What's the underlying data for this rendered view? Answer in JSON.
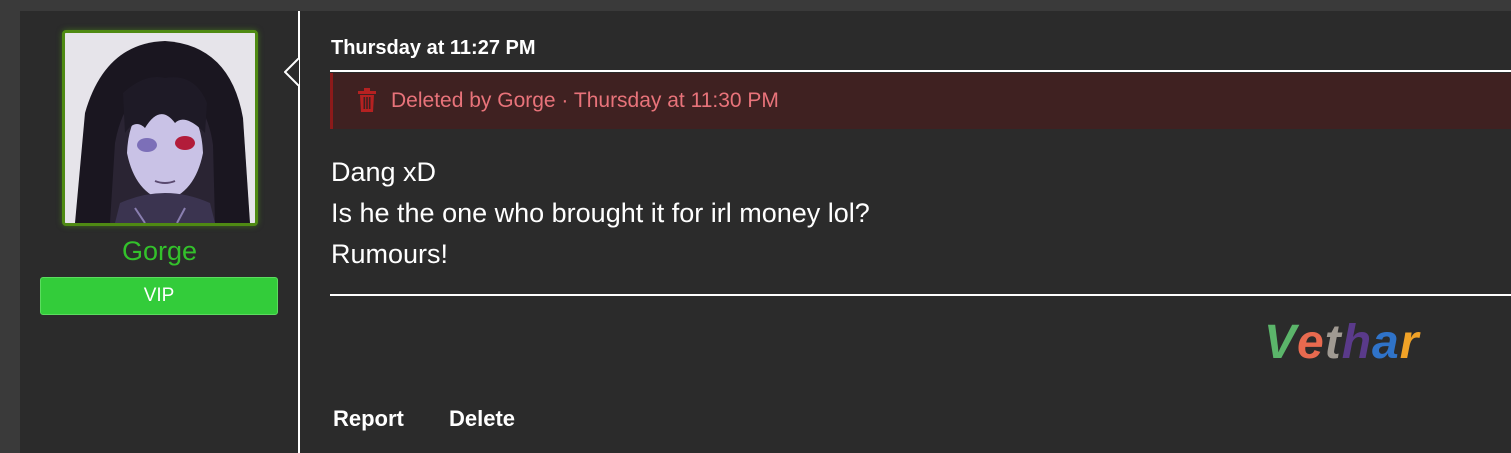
{
  "post": {
    "author": {
      "name": "Gorge",
      "badge": "VIP",
      "name_color": "#33c12b",
      "badge_color": "#33cc3a",
      "avatar_icon": "anime-avatar-image"
    },
    "timestamp": "Thursday at 11:27 PM",
    "deleted_notice": {
      "icon": "trash-icon",
      "text": "Deleted by Gorge · Thursday at 11:30 PM",
      "text_color": "#e8737a",
      "background": "#3f2121"
    },
    "message_lines": [
      "Dang xD",
      "Is he the one who brought it for irl money lol?",
      "Rumours!"
    ],
    "signature": {
      "letters": [
        {
          "char": "V",
          "color": "#5bb56a"
        },
        {
          "char": "e",
          "color": "#e86a4f"
        },
        {
          "char": "t",
          "color": "#a09a92"
        },
        {
          "char": "h",
          "color": "#5a3a8a"
        },
        {
          "char": "a",
          "color": "#2f73c9"
        },
        {
          "char": "r",
          "color": "#f0a227"
        }
      ]
    },
    "actions": {
      "report": "Report",
      "delete": "Delete"
    }
  }
}
